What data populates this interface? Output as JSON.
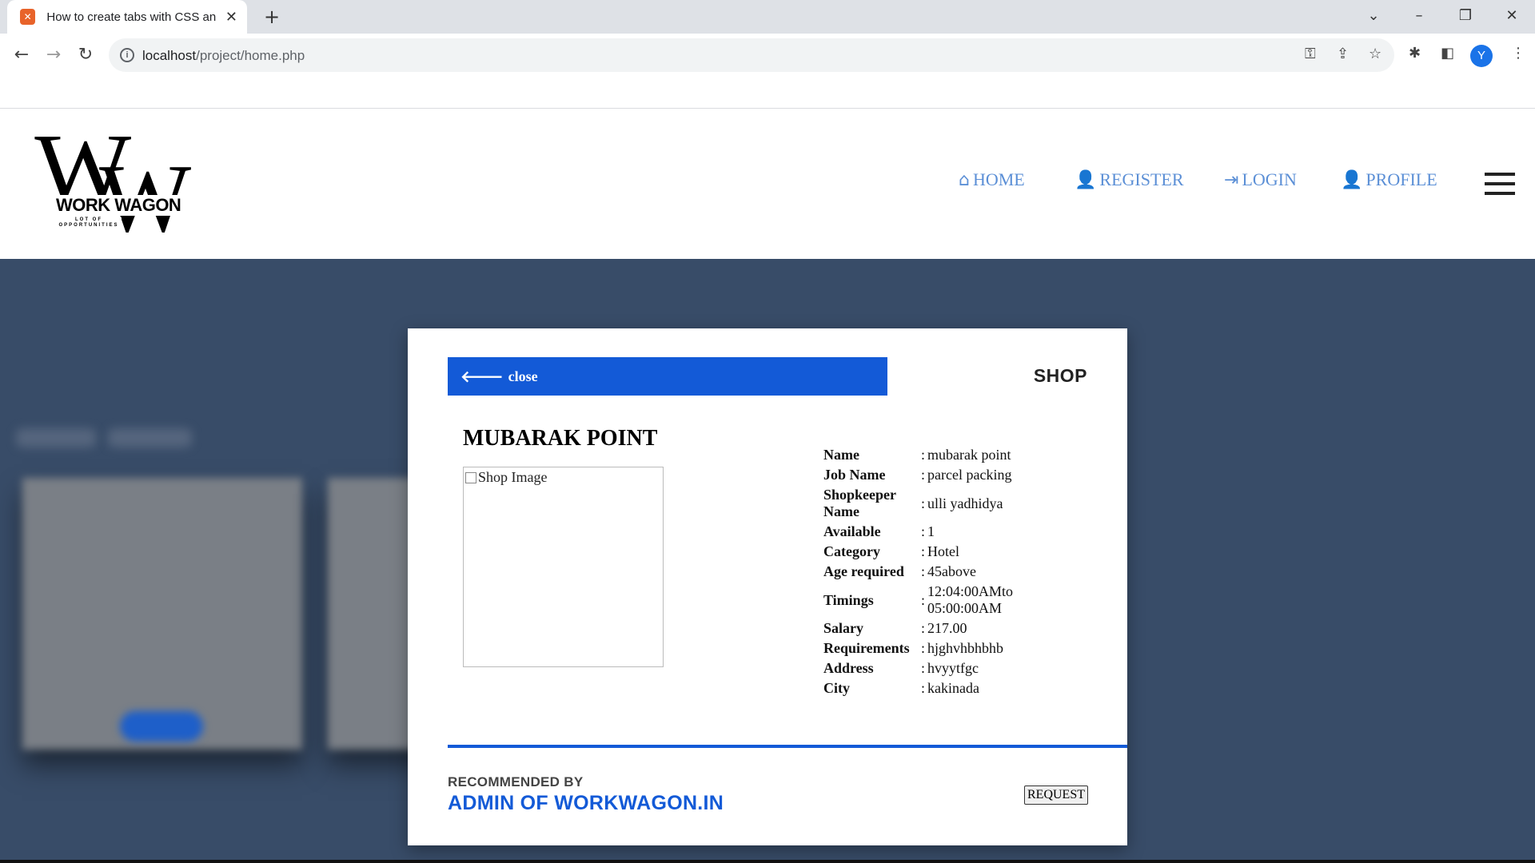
{
  "browser": {
    "tab_title": "How to create tabs with CSS and",
    "tab_favicon": "xampp-icon",
    "url_host": "localhost",
    "url_path": "/project/home.php",
    "profile_initial": "Y"
  },
  "site": {
    "logo_brand": "WORK WAGON",
    "logo_letters": "W",
    "logo_tagline": "LOT OF OPPORTUNITIES",
    "nav": [
      {
        "label": "HOME",
        "icon": "home-icon"
      },
      {
        "label": "REGISTER",
        "icon": "user-plus-icon"
      },
      {
        "label": "LOGIN",
        "icon": "sign-in-icon"
      },
      {
        "label": "PROFILE",
        "icon": "user-icon"
      }
    ]
  },
  "modal": {
    "close_label": "close",
    "type_tag": "SHOP",
    "shop_name": "MUBARAK POINT",
    "image_alt": "Shop Image",
    "details": [
      {
        "key": "Name",
        "value": "mubarak point"
      },
      {
        "key": "Job Name",
        "value": "parcel packing"
      },
      {
        "key": "Shopkeeper Name",
        "value": "ulli yadhidya"
      },
      {
        "key": "Available",
        "value": "1"
      },
      {
        "key": "Category",
        "value": "Hotel"
      },
      {
        "key": "Age required",
        "value": "45above"
      },
      {
        "key": "Timings",
        "value": "12:04:00AMto 05:00:00AM"
      },
      {
        "key": "Salary",
        "value": "217.00"
      },
      {
        "key": "Requirements",
        "value": "hjghvhbhbhb"
      },
      {
        "key": "Address",
        "value": "hvyytfgc"
      },
      {
        "key": "City",
        "value": "kakinada"
      }
    ],
    "separator": ":",
    "recommended_label": "RECOMMENDED BY",
    "recommended_by": "ADMIN OF WORKWAGON.IN",
    "request_label": "REQUEST"
  },
  "colors": {
    "accent": "#135ad7",
    "nav_link": "#5b8fd6",
    "page_bg": "#384c68"
  }
}
